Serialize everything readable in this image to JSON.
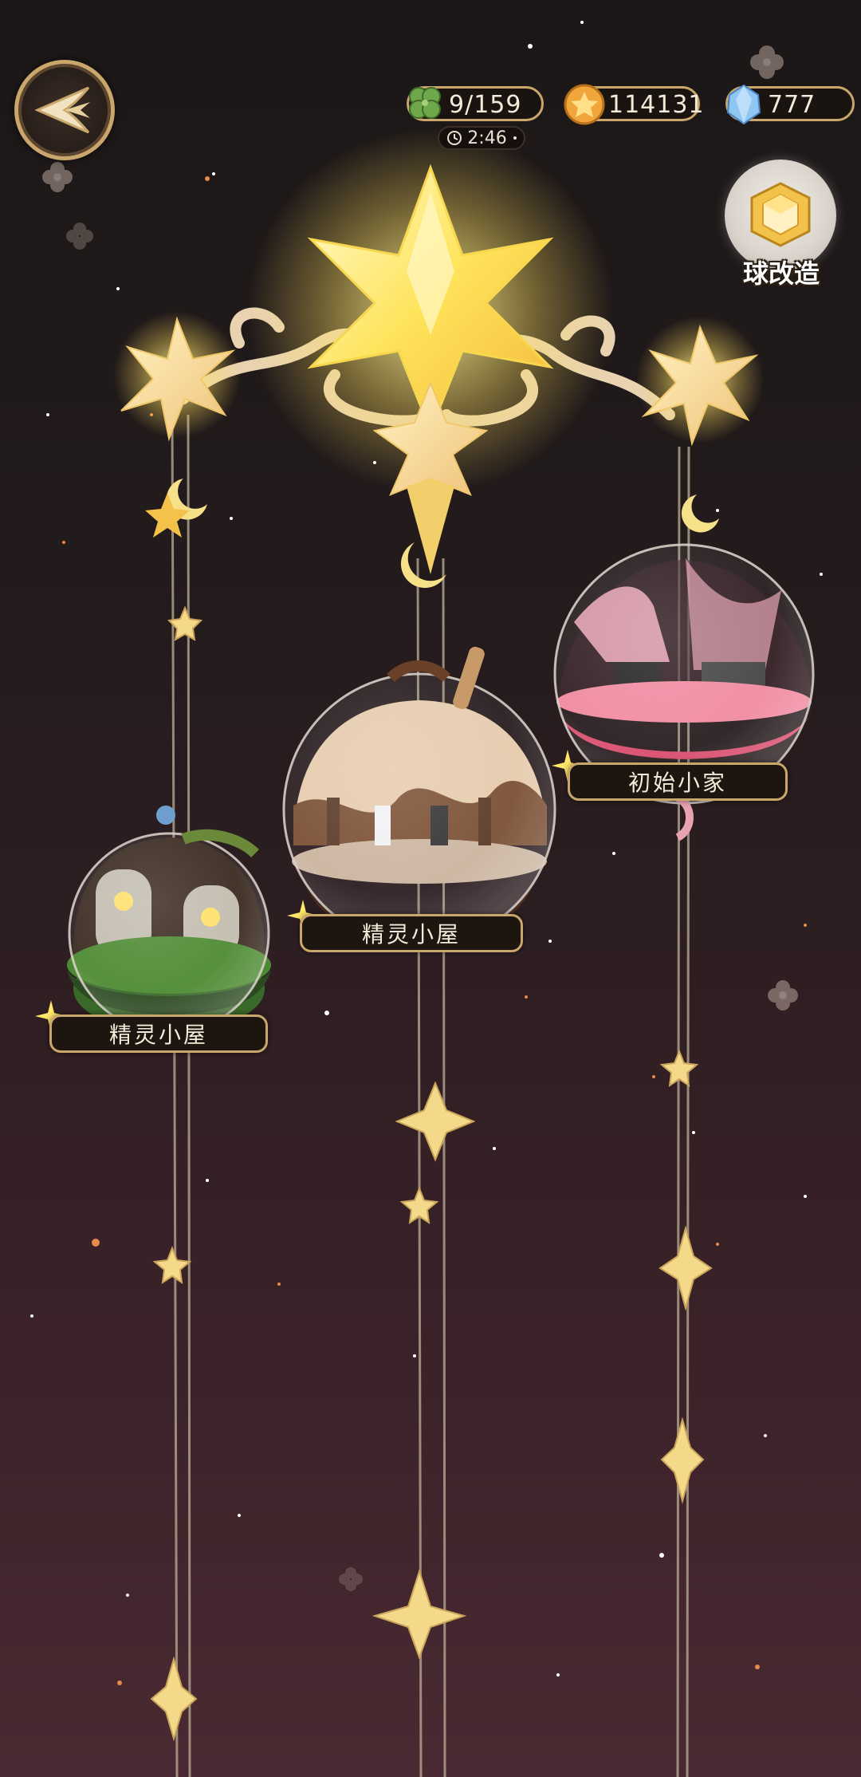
{
  "hud": {
    "back_icon": "back-arrow-icon",
    "clover": {
      "icon": "clover-icon",
      "value": "9/159",
      "color": "#6fa84a"
    },
    "coins": {
      "icon": "star-coin-icon",
      "value": "114131",
      "color": "#f0a63a"
    },
    "gems": {
      "icon": "crystal-icon",
      "value": "777",
      "color": "#8fc6f2"
    },
    "timer": {
      "icon": "clock-icon",
      "value": "2:46"
    },
    "rebuild": {
      "icon": "cube-icon",
      "label": "球改造"
    }
  },
  "houses": [
    {
      "name": "精灵小屋",
      "theme": "green-garden"
    },
    {
      "name": "精灵小屋",
      "theme": "chocolate"
    },
    {
      "name": "初始小家",
      "theme": "pink-candy"
    }
  ],
  "colors": {
    "gold": "#c9a66b",
    "star_yellow": "#ffe86a",
    "bg_top": "#1c1717",
    "bg_bottom": "#4a2a32"
  }
}
